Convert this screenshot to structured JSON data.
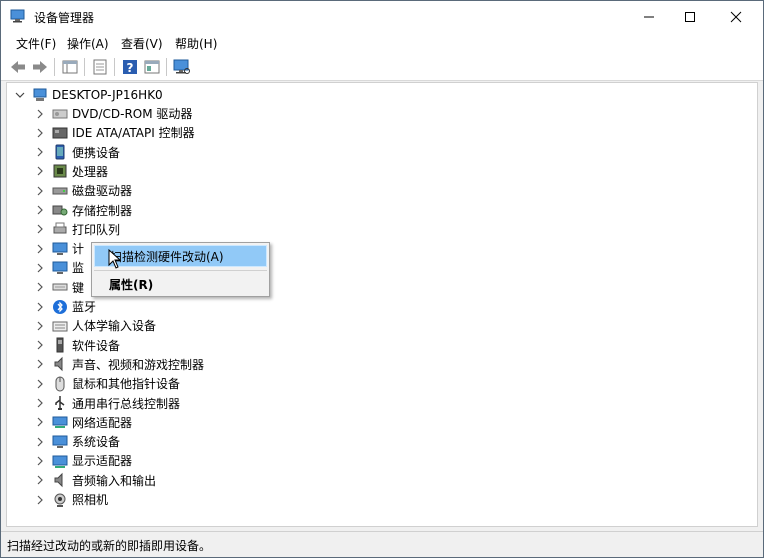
{
  "window": {
    "title": "设备管理器",
    "controls": {
      "minimize": "—",
      "maximize": "☐",
      "close": "✕"
    }
  },
  "menubar": {
    "items": [
      "文件(F)",
      "操作(A)",
      "查看(V)",
      "帮助(H)"
    ]
  },
  "toolbar": {
    "buttons": [
      "back-icon",
      "forward-icon",
      "properties-pane-icon",
      "list-icon",
      "help-icon",
      "view-icon",
      "monitor-scan-icon"
    ]
  },
  "tree": {
    "root": "DESKTOP-JP16HK0",
    "items": [
      {
        "label": "DVD/CD-ROM 驱动器",
        "icon": "dvd-drive-icon"
      },
      {
        "label": "IDE ATA/ATAPI 控制器",
        "icon": "ide-controller-icon"
      },
      {
        "label": "便携设备",
        "icon": "portable-device-icon"
      },
      {
        "label": "处理器",
        "icon": "processor-icon"
      },
      {
        "label": "磁盘驱动器",
        "icon": "disk-drive-icon"
      },
      {
        "label": "存储控制器",
        "icon": "storage-controller-icon"
      },
      {
        "label": "打印队列",
        "icon": "printer-icon"
      },
      {
        "label": "计",
        "icon": "computer-icon"
      },
      {
        "label": "监",
        "icon": "monitor-icon"
      },
      {
        "label": "键",
        "icon": "keyboard-icon"
      },
      {
        "label": "蓝牙",
        "icon": "bluetooth-icon"
      },
      {
        "label": "人体学输入设备",
        "icon": "hid-icon"
      },
      {
        "label": "软件设备",
        "icon": "software-device-icon"
      },
      {
        "label": "声音、视频和游戏控制器",
        "icon": "sound-icon"
      },
      {
        "label": "鼠标和其他指针设备",
        "icon": "mouse-icon"
      },
      {
        "label": "通用串行总线控制器",
        "icon": "usb-icon"
      },
      {
        "label": "网络适配器",
        "icon": "network-adapter-icon"
      },
      {
        "label": "系统设备",
        "icon": "system-device-icon"
      },
      {
        "label": "显示适配器",
        "icon": "display-adapter-icon"
      },
      {
        "label": "音频输入和输出",
        "icon": "audio-io-icon"
      },
      {
        "label": "照相机",
        "icon": "camera-icon"
      }
    ]
  },
  "context_menu": {
    "scan_label": "扫描检测硬件改动(A)",
    "properties_label": "属性(R)"
  },
  "status": {
    "text": "扫描经过改动的或新的即插即用设备。"
  },
  "colors": {
    "highlight": "#91c9f7",
    "accent": "#0078d7"
  }
}
